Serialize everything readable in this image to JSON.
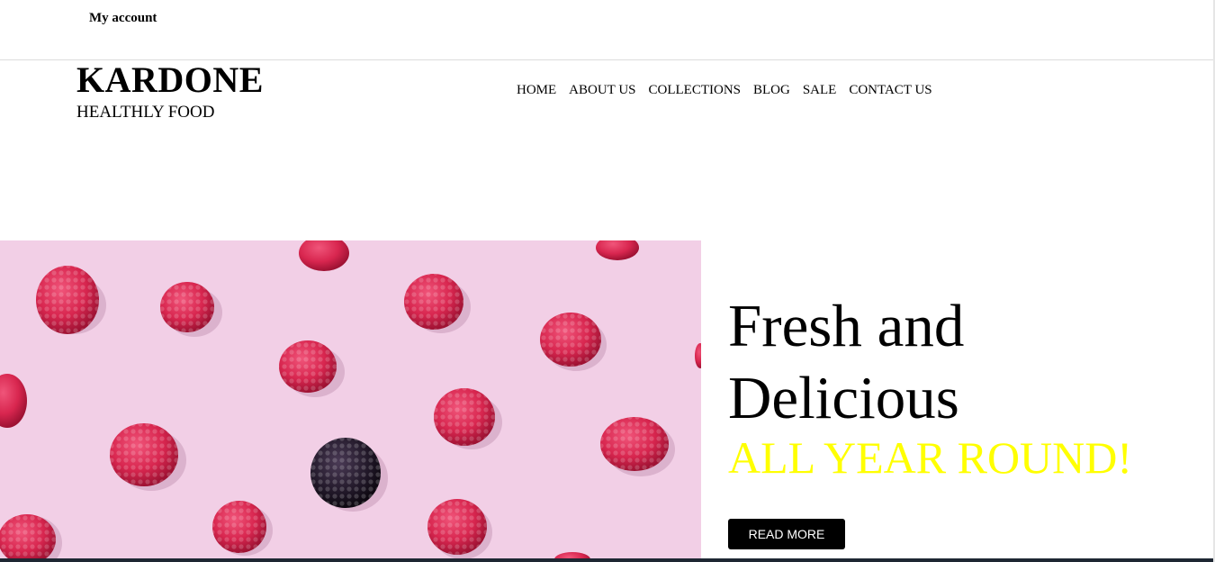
{
  "topbar": {
    "my_account": "My account"
  },
  "brand": {
    "title": "KARDONE",
    "subtitle": "HEALTHLY FOOD"
  },
  "nav": {
    "items": [
      {
        "label": "HOME"
      },
      {
        "label": "ABOUT US"
      },
      {
        "label": "COLLECTIONS"
      },
      {
        "label": "BLOG"
      },
      {
        "label": "SALE"
      },
      {
        "label": "CONTACT US"
      }
    ]
  },
  "hero": {
    "title_line1": "Fresh and",
    "title_line2": "Delicious",
    "tagline": "ALL YEAR ROUND!",
    "cta_label": "READ MORE",
    "image_subject": "raspberries and a blackberry on pink background",
    "colors": {
      "tagline": "#ffff00",
      "image_bg": "#f2cfe6",
      "raspberry": "#d8264f",
      "blackberry": "#1f1626",
      "button_bg": "#000000"
    }
  }
}
